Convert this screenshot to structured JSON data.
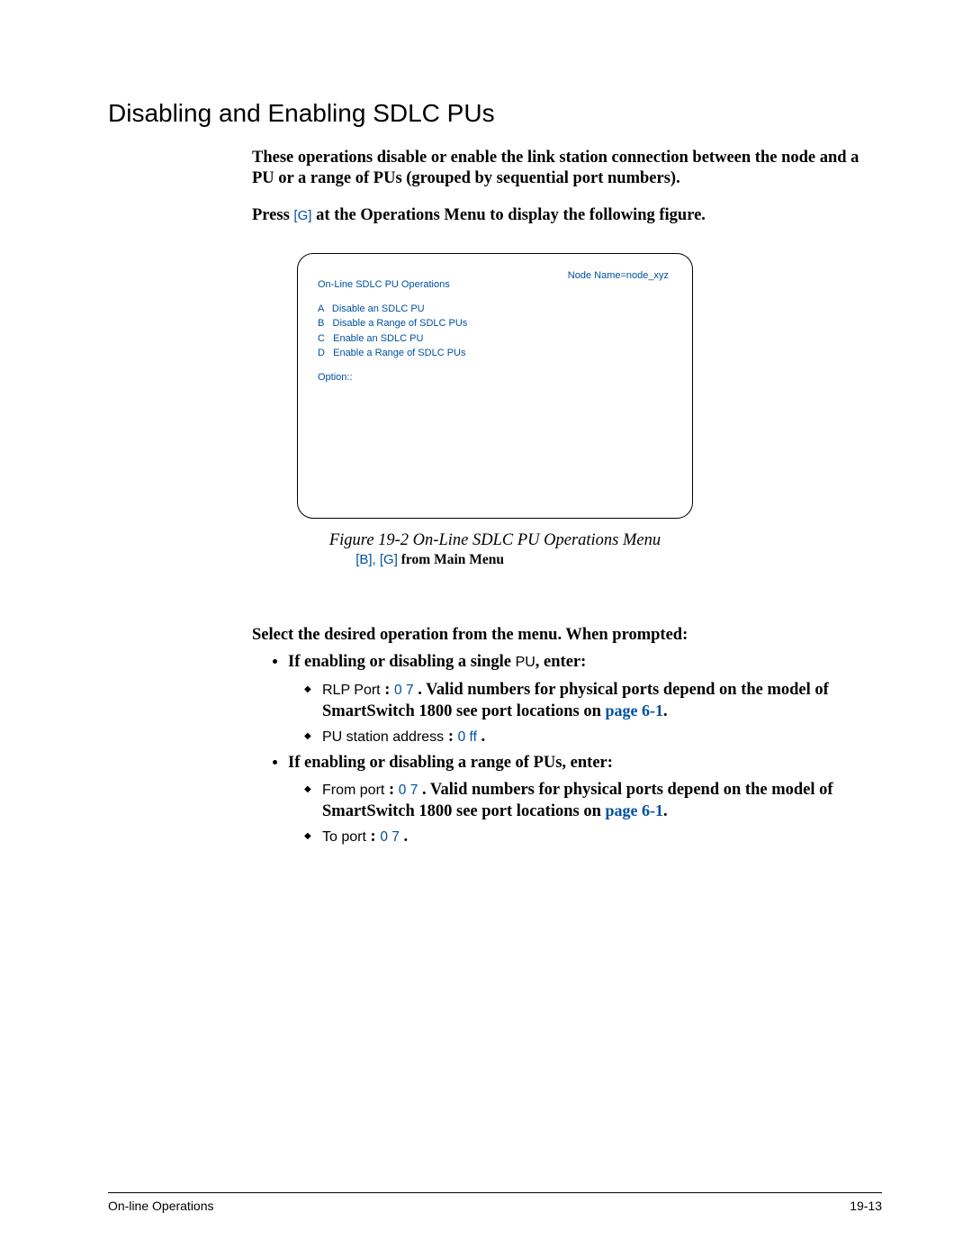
{
  "heading": "Disabling and Enabling SDLC PUs",
  "intro": {
    "p1": "These operations disable or enable the link station connection between the node and a PU or a range of PUs (grouped by sequential port numbers).",
    "press_prefix": "Press ",
    "press_key": "[G]",
    "press_suffix": " at the Operations Menu to display the following figure."
  },
  "terminal": {
    "node": "Node Name=node_xyz",
    "title": "On-Line SDLC PU Operations",
    "opts": [
      "A   Disable an SDLC PU",
      "B   Disable a Range of SDLC PUs",
      "C   Enable an SDLC PU",
      "D   Enable a Range of SDLC PUs"
    ],
    "prompt": "Option::"
  },
  "figure": {
    "caption": "Figure 19-2    On-Line SDLC PU Operations Menu",
    "sub_key": "[B], [G]",
    "sub_text": " from Main Menu"
  },
  "select": "Select the desired operation from the menu. When prompted:",
  "list": {
    "single_prefix": "If enabling or disabling a single ",
    "single_pu": "PU",
    "single_suffix": ", enter:",
    "rlp_label": "RLP Port",
    "rlp_colon": " : ",
    "rlp_val": "0 7",
    "rlp_period": " . ",
    "rlp_text": "Valid numbers for physical ports depend on the model of SmartSwitch 1800 see port locations on ",
    "page_ref": "page 6-1",
    "pu_addr_label": "PU station address",
    "pu_addr_colon": "  : ",
    "pu_addr_val": "0 ff",
    "pu_addr_period": " .",
    "range_text": "If enabling or disabling a range of PUs, enter:",
    "from_label": "From port",
    "from_colon": "  : ",
    "from_val": "0 7",
    "from_period": " . ",
    "from_text": "Valid numbers for physical ports depend on the model of SmartSwitch 1800 see port locations on ",
    "to_label": "To port",
    "to_colon": " : ",
    "to_val": "0 7",
    "to_period": " ."
  },
  "footer": {
    "left": "On-line Operations",
    "right": "19-13"
  }
}
